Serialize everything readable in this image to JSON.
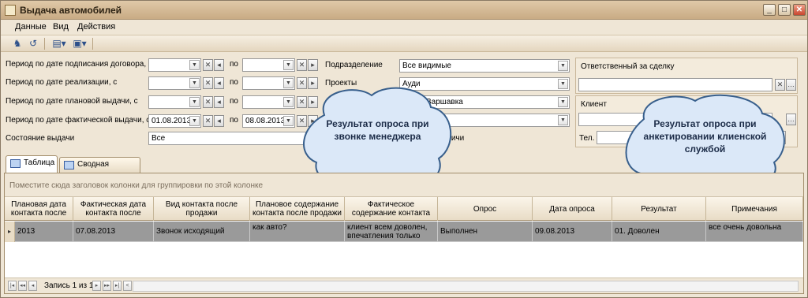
{
  "window": {
    "title": "Выдача автомобилей"
  },
  "menu": {
    "items": [
      "Данные",
      "Вид",
      "Действия"
    ]
  },
  "filters": {
    "period_sign": {
      "label": "Период по дате подписания договора, с",
      "from": "",
      "to_label": "по",
      "to": ""
    },
    "period_sale": {
      "label": "Период по дате реализации, с",
      "from": "",
      "to_label": "по",
      "to": ""
    },
    "period_plan": {
      "label": "Период по дате плановой выдачи, с",
      "from": "",
      "to_label": "по",
      "to": ""
    },
    "period_fact": {
      "label": "Период по дате фактической выдачи, с",
      "from": "01.08.2013",
      "to_label": "по",
      "to": "08.08.2013"
    },
    "status": {
      "label": "Состояние выдачи",
      "value": "Все"
    },
    "division": {
      "label": "Подразделение",
      "value": "Все видимые"
    },
    "projects": {
      "label": "Проекты",
      "value": "Ауди"
    },
    "row3_value": "Варшавка",
    "row5_label_fragment": "личи"
  },
  "responsible": {
    "title": "Ответственный за сделку",
    "value": ""
  },
  "client": {
    "title": "Клиент",
    "value": "",
    "phone_label": "Тел.",
    "phone": ""
  },
  "callouts": {
    "left": "Результат опроса при звонке менеджера",
    "right": "Результат опроса при анкетировании клиенской службой"
  },
  "tabs": [
    {
      "label": "Таблица",
      "active": true
    },
    {
      "label": "Сводная таблица",
      "active": false
    }
  ],
  "grid": {
    "group_hint": "Поместите сюда заголовок колонки для группировки по этой колонке",
    "columns": [
      "Плановая дата контакта после",
      "Фактическая дата контакта после",
      "Вид контакта после продажи",
      "Плановое содержание контакта после продажи",
      "Фактическое содержание контакта",
      "Опрос",
      "Дата опроса",
      "Результат",
      "Примечания"
    ],
    "rows": [
      [
        "2013",
        "07.08.2013",
        "Звонок исходящий",
        "как авто?",
        "клиент всем доволен, впечатления только",
        "Выполнен",
        "09.08.2013",
        "01. Доволен",
        "все очень довольна"
      ]
    ]
  },
  "navigator": {
    "record_text": "Запись 1 из 1"
  }
}
